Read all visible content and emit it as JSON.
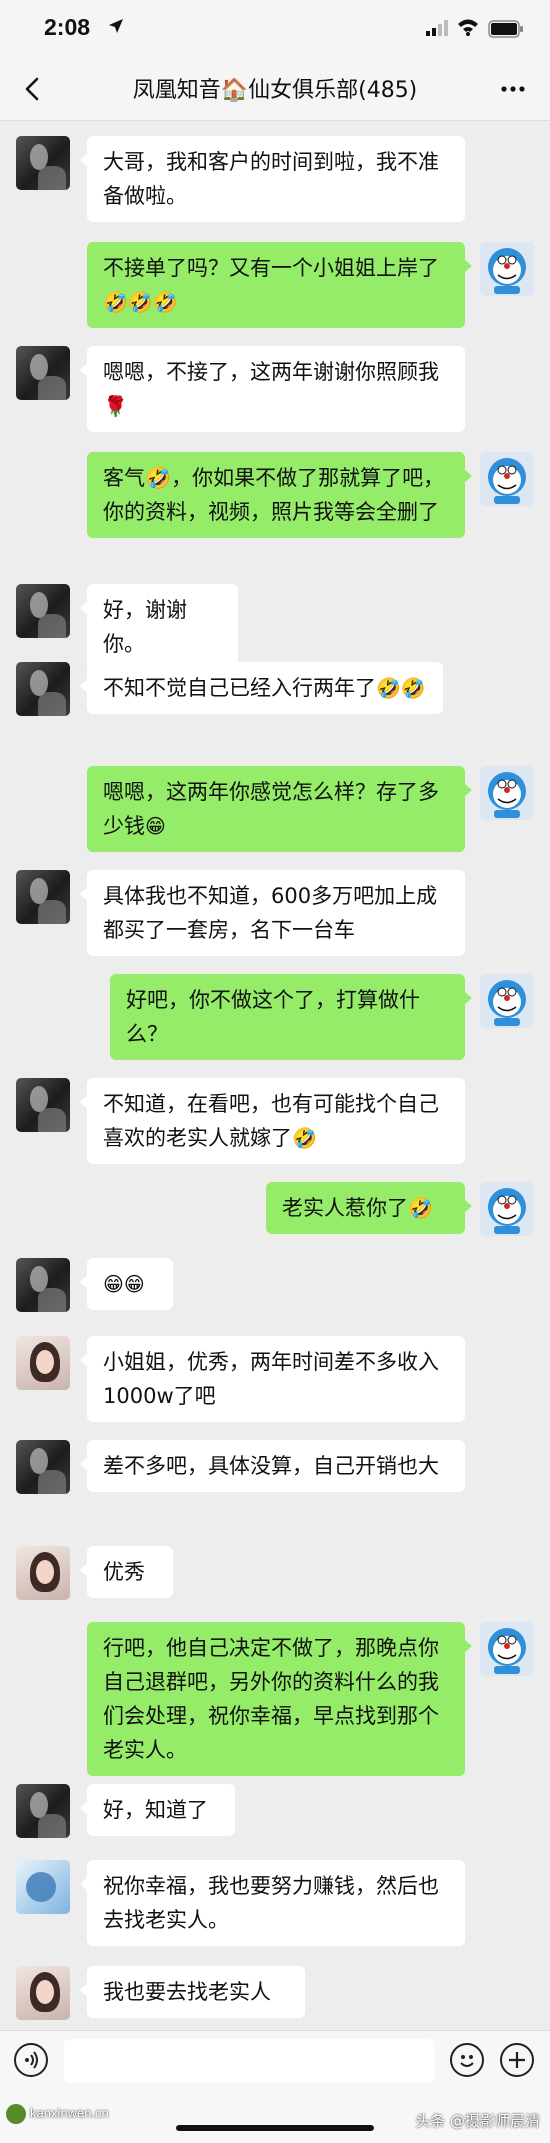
{
  "status_bar": {
    "time": "2:08"
  },
  "header": {
    "title": "凤凰知音🏠仙女俱乐部(485)"
  },
  "colors": {
    "my_bubble": "#95ec69",
    "other_bubble": "#ffffff",
    "background": "#ededed"
  },
  "messages": [
    {
      "side": "left",
      "avatar": "dark-photo",
      "text": "大哥，我和客户的时间到啦，我不准备做啦。",
      "emojis": ""
    },
    {
      "side": "right",
      "avatar": "doraemon",
      "text": "不接单了吗？又有一个小姐姐上岸了",
      "emojis": "🤣🤣🤣"
    },
    {
      "side": "left",
      "avatar": "dark-photo",
      "text": "嗯嗯，不接了，这两年谢谢你照顾我",
      "emojis": "🌹"
    },
    {
      "side": "right",
      "avatar": "doraemon",
      "text": "客气🤣，你如果不做了那就算了吧，你的资料，视频，照片我等会全删了",
      "emojis": ""
    },
    {
      "side": "left",
      "avatar": "dark-photo",
      "text": "好，谢谢你。",
      "emojis": ""
    },
    {
      "side": "left",
      "avatar": "dark-photo",
      "text": "不知不觉自己已经入行两年了",
      "emojis": "🤣🤣"
    },
    {
      "side": "right",
      "avatar": "doraemon",
      "text": "嗯嗯，这两年你感觉怎么样？存了多少钱",
      "emojis": "😁"
    },
    {
      "side": "left",
      "avatar": "dark-photo",
      "text": "具体我也不知道，600多万吧加上成都买了一套房，名下一台车",
      "emojis": ""
    },
    {
      "side": "right",
      "avatar": "doraemon",
      "text": "好吧，你不做这个了，打算做什么？",
      "emojis": ""
    },
    {
      "side": "left",
      "avatar": "dark-photo",
      "text": "不知道，在看吧，也有可能找个自己喜欢的老实人就嫁了",
      "emojis": "🤣"
    },
    {
      "side": "right",
      "avatar": "doraemon",
      "text": "老实人惹你了",
      "emojis": "🤣"
    },
    {
      "side": "left",
      "avatar": "dark-photo",
      "text": "",
      "emojis": "😁😁"
    },
    {
      "side": "left",
      "avatar": "girl-photo",
      "text": "小姐姐，优秀，两年时间差不多收入1000w了吧",
      "emojis": ""
    },
    {
      "side": "left",
      "avatar": "dark-photo",
      "text": "差不多吧，具体没算，自己开销也大",
      "emojis": ""
    },
    {
      "side": "left",
      "avatar": "girl-photo-2",
      "text": "优秀",
      "emojis": ""
    },
    {
      "side": "right",
      "avatar": "doraemon",
      "text": "行吧，他自己决定不做了，那晚点你自己退群吧，另外你的资料什么的我们会处理，祝你幸福，早点找到那个老实人。",
      "emojis": ""
    },
    {
      "side": "left",
      "avatar": "dark-photo",
      "text": "好，知道了",
      "emojis": ""
    },
    {
      "side": "left",
      "avatar": "blue-photo",
      "text": "祝你幸福，我也要努力赚钱，然后也去找老实人。",
      "emojis": ""
    },
    {
      "side": "left",
      "avatar": "girl-photo-3",
      "text": "我也要去找老实人",
      "emojis": ""
    }
  ],
  "watermarks": {
    "left": "kanxinwen.cn",
    "right": "头条 @摄影师晨清"
  }
}
